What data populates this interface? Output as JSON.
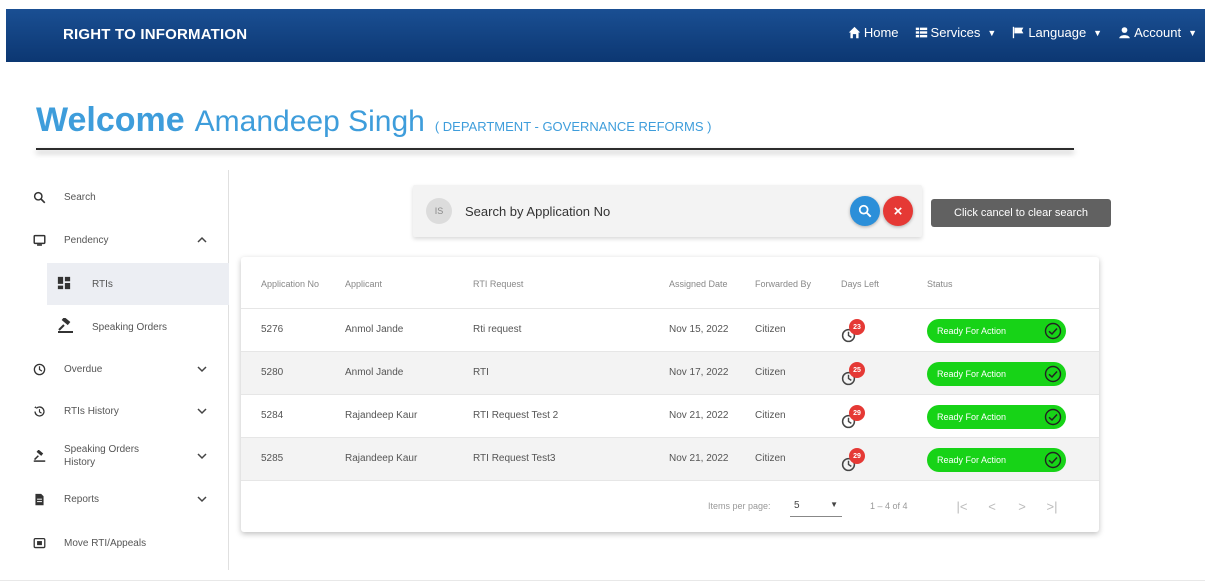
{
  "navbar": {
    "brand": "RIGHT TO INFORMATION",
    "items": [
      {
        "label": "Home",
        "icon": "home-icon"
      },
      {
        "label": "Services",
        "icon": "grid-icon",
        "dropdown": true
      },
      {
        "label": "Language",
        "icon": "flag-icon",
        "dropdown": true
      },
      {
        "label": "Account",
        "icon": "user-icon",
        "dropdown": true
      }
    ],
    "bg_color": "#0c3772"
  },
  "welcome": {
    "greeting": "Welcome",
    "name": "Amandeep Singh",
    "department": "( DEPARTMENT - GOVERNANCE REFORMS )",
    "color": "#3e9ddb"
  },
  "sidebar": {
    "items": [
      {
        "label": "Search",
        "icon": "search-icon"
      },
      {
        "label": "Pendency",
        "icon": "monitor-icon",
        "expanded": true
      },
      {
        "label": "RTIs",
        "icon": "dashboard-icon",
        "active": true
      },
      {
        "label": "Speaking Orders",
        "icon": "gavel-icon"
      },
      {
        "label": "Overdue",
        "icon": "clock-icon"
      },
      {
        "label": "RTIs History",
        "icon": "history-icon"
      },
      {
        "label": "Speaking Orders",
        "label2": "History",
        "icon": "gavel-icon"
      },
      {
        "label": "Reports",
        "icon": "document-icon"
      },
      {
        "label": "Move RTI/Appeals",
        "icon": "move-icon"
      }
    ]
  },
  "search": {
    "badge": "IS",
    "placeholder": "Search by Application No",
    "tooltip": "Click cancel to clear search",
    "cancel_glyph": "×"
  },
  "table": {
    "headers": [
      "Application No",
      "Applicant",
      "RTI Request",
      "Assigned Date",
      "Forwarded By",
      "Days Left",
      "Status"
    ],
    "rows": [
      {
        "app_no": "5276",
        "applicant": "Anmol Jande",
        "request": "Rti request",
        "date": "Nov 15, 2022",
        "forwarded_by": "Citizen",
        "days_left": "23",
        "status": "Ready For Action"
      },
      {
        "app_no": "5280",
        "applicant": "Anmol Jande",
        "request": "RTI",
        "date": "Nov 17, 2022",
        "forwarded_by": "Citizen",
        "days_left": "25",
        "status": "Ready For Action"
      },
      {
        "app_no": "5284",
        "applicant": "Rajandeep Kaur",
        "request": "RTI Request Test 2",
        "date": "Nov 21, 2022",
        "forwarded_by": "Citizen",
        "days_left": "29",
        "status": "Ready For Action"
      },
      {
        "app_no": "5285",
        "applicant": "Rajandeep Kaur",
        "request": "RTI Request Test3",
        "date": "Nov 21, 2022",
        "forwarded_by": "Citizen",
        "days_left": "29",
        "status": "Ready For Action"
      }
    ],
    "status_color": "#17d317"
  },
  "pager": {
    "items_per_page_label": "Items per page:",
    "items_per_page": "5",
    "range": "1 – 4 of 4",
    "dropdown_glyph": "▼",
    "buttons": [
      "|<",
      "<",
      ">",
      ">|"
    ]
  }
}
